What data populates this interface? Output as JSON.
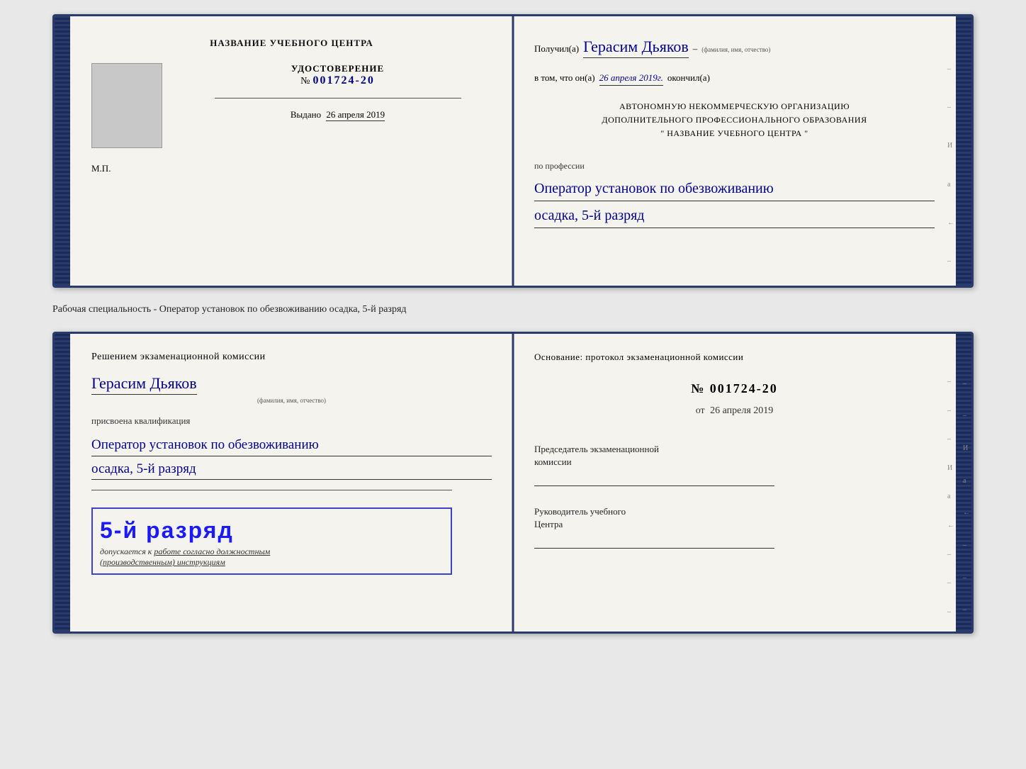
{
  "cert_top": {
    "left": {
      "title": "НАЗВАНИЕ УЧЕБНОГО ЦЕНТРА",
      "doc_label": "УДОСТОВЕРЕНИЕ",
      "doc_number_prefix": "№",
      "doc_number": "001724-20",
      "issued_label": "Выдано",
      "issued_date": "26 апреля 2019",
      "mp_label": "М.П."
    },
    "right": {
      "received_label": "Получил(а)",
      "received_name": "Герасим Дьяков",
      "name_sub": "(фамилия, имя, отчество)",
      "dash": "–",
      "in_that_label": "в том, что он(а)",
      "date_value": "26 апреля 2019г.",
      "finished_label": "окончил(а)",
      "org_line1": "АВТОНОМНУЮ НЕКОММЕРЧЕСКУЮ ОРГАНИЗАЦИЮ",
      "org_line2": "ДОПОЛНИТЕЛЬНОГО ПРОФЕССИОНАЛЬНОГО ОБРАЗОВАНИЯ",
      "org_line3": "\"    НАЗВАНИЕ УЧЕБНОГО ЦЕНТРА    \"",
      "profession_label": "по профессии",
      "profession_line1": "Оператор установок по обезвоживанию",
      "profession_line2": "осадка, 5-й разряд"
    }
  },
  "cert_label": "Рабочая специальность - Оператор установок по обезвоживанию осадка, 5-й разряд",
  "cert_bottom": {
    "left": {
      "decision_title": "Решением экзаменационной комиссии",
      "person_name": "Герасим Дьяков",
      "name_sub": "(фамилия, имя, отчество)",
      "qualification_label": "присвоена квалификация",
      "qualification_line1": "Оператор установок по обезвоживанию",
      "qualification_line2": "осадка, 5-й разряд",
      "rank_text": "5-й разряд",
      "dopusk_label": "допускается к",
      "dopusk_value": "работе согласно должностным",
      "dopusk_value2": "(производственным) инструкциям"
    },
    "right": {
      "osnov_label": "Основание: протокол экзаменационной комиссии",
      "protocol_num": "№ 001724-20",
      "date_prefix": "от",
      "date_value": "26 апреля 2019",
      "chairman_label": "Председатель экзаменационной",
      "chairman_label2": "комиссии",
      "head_label": "Руководитель учебного",
      "head_label2": "Центра"
    }
  },
  "side_marks": {
    "marks": [
      "–",
      "–",
      "И",
      "а",
      "←",
      "–",
      "–",
      "–",
      "–"
    ]
  }
}
